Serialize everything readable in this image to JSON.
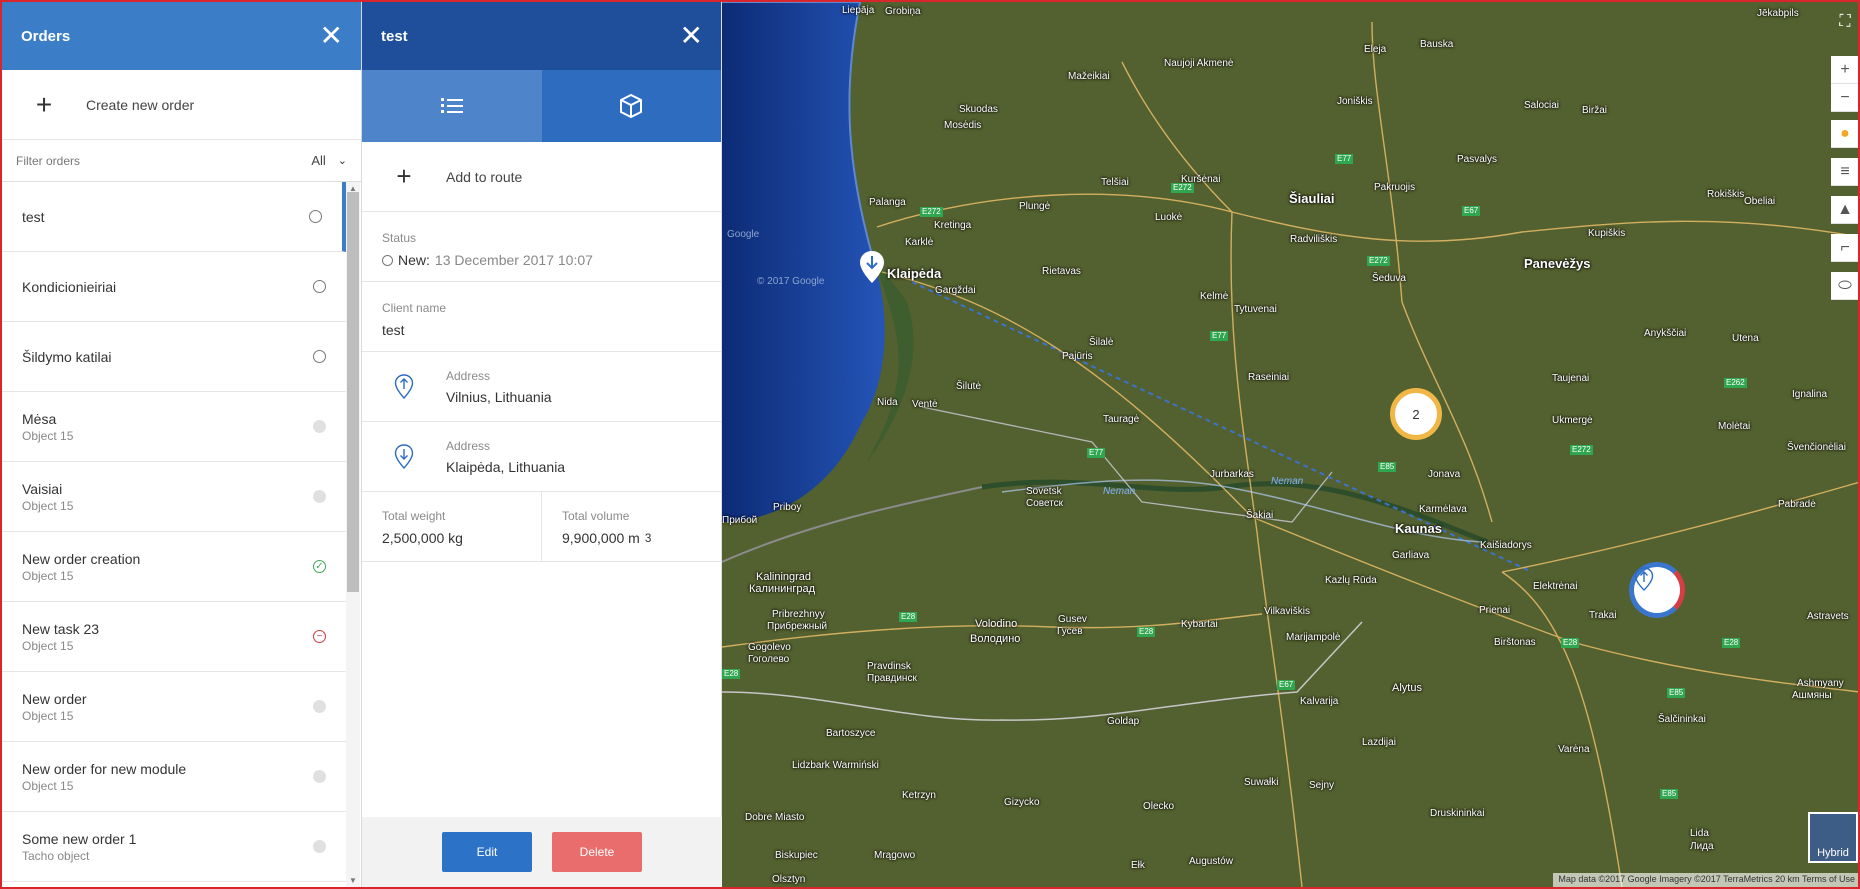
{
  "orders_panel": {
    "title": "Orders",
    "create_label": "Create new order",
    "filter_placeholder": "Filter orders",
    "filter_value": "All",
    "items": [
      {
        "title": "test",
        "subtitle": "",
        "status": "open",
        "active": true
      },
      {
        "title": "Kondicionieiriai",
        "subtitle": "",
        "status": "open"
      },
      {
        "title": "Šildymo katilai",
        "subtitle": "",
        "status": "open"
      },
      {
        "title": "Mėsa",
        "subtitle": "Object 15",
        "status": "grey"
      },
      {
        "title": "Vaisiai",
        "subtitle": "Object 15",
        "status": "grey"
      },
      {
        "title": "New order creation",
        "subtitle": "Object 15",
        "status": "ok"
      },
      {
        "title": "New task 23",
        "subtitle": "Object 15",
        "status": "stop"
      },
      {
        "title": "New order",
        "subtitle": "Object 15",
        "status": "grey"
      },
      {
        "title": "New order for new module",
        "subtitle": "Object 15",
        "status": "grey"
      },
      {
        "title": "Some new order 1",
        "subtitle": "Tacho object",
        "status": "grey"
      }
    ]
  },
  "detail_panel": {
    "title": "test",
    "add_route_label": "Add to route",
    "status_label": "Status",
    "status_value": "New:",
    "status_date": "13 December 2017 10:07",
    "client_label": "Client name",
    "client_value": "test",
    "address_from_label": "Address",
    "address_from_value": "Vilnius, Lithuania",
    "address_to_label": "Address",
    "address_to_value": "Klaipėda, Lithuania",
    "weight_label": "Total weight",
    "weight_value": "2,500,000 kg",
    "volume_label": "Total volume",
    "volume_value": "9,900,000 m",
    "volume_unit_power": "3",
    "edit_label": "Edit",
    "delete_label": "Delete"
  },
  "map": {
    "hybrid_label": "Hybrid",
    "attribution": "Map data ©2017 Google Imagery ©2017 TerraMetrics   20 km   Terms of Use",
    "cluster_count": "2",
    "labels": [
      "Liepāja",
      "Grobiņa",
      "Jēkabpils",
      "Naujoji Akmenė",
      "Mažeikiai",
      "Eleja",
      "Bauska",
      "Skuodas",
      "Joniškis",
      "Biržai",
      "Mosėdis",
      "Salociai",
      "Pasvalys",
      "Palanga",
      "Telšiai",
      "Kuršėnai",
      "Šiauliai",
      "Pakruojis",
      "Kretinga",
      "Plungė",
      "Luokė",
      "Kupiškis",
      "Rokiškis",
      "Obeliai",
      "Klaipėda",
      "Karklė",
      "Gargždai",
      "Rietavas",
      "Radviliškis",
      "Panevėžys",
      "Šeduva",
      "Kelmė",
      "Tytuvenai",
      "Šilalė",
      "Pajūris",
      "Anykščiai",
      "Utena",
      "Raseiniai",
      "Nida",
      "Ventė",
      "Šilutė",
      "Tauragė",
      "Ukmergė",
      "Taujenai",
      "Molėtai",
      "Ignalina",
      "Švenčionėliai",
      "Jurbarkas",
      "Jonava",
      "Pabradė",
      "Sovetsk",
      "Советск",
      "Neman",
      "Šakiai",
      "Kaunas",
      "Karmėlava",
      "Kaišiadorys",
      "Priboy",
      "Прибой",
      "Kaliningrad",
      "Калининград",
      "Garliava",
      "Elektrėnai",
      "Trakai",
      "Astravets",
      "Pribrezhnyy",
      "Прибрежный",
      "Volodino",
      "Володино",
      "Gusev",
      "Гусев",
      "Kybartai",
      "Vilkaviškis",
      "Kazlų Rūda",
      "Prienai",
      "Birštonas",
      "Marijampolė",
      "Gogolevo",
      "Гоголево",
      "Pravdinsk",
      "Правдинск",
      "Kalvarija",
      "Alytus",
      "Ashmyany",
      "Ашмяны",
      "Šalčininkai",
      "Goldap",
      "Bartoszyce",
      "Lazdijai",
      "Varėna",
      "Lidzbark Warmiński",
      "Ketrzyn",
      "Suwałki",
      "Sejny",
      "Gizycko",
      "Olecko",
      "Druskininkai",
      "Dobre Miasto",
      "Biskupiec",
      "Mrągowo",
      "Ełk",
      "Augustów",
      "Lida",
      "Лида",
      "Olsztyn",
      "Google",
      "© 2017 Google",
      "Neman"
    ]
  },
  "colors": {
    "orders_header": "#3b7dc7",
    "detail_header": "#1f4f9b",
    "edit_button": "#2c73c7",
    "delete_button": "#ea6d6e",
    "ok_status": "#42a95c",
    "stop_status": "#d63b43"
  },
  "icons": {
    "plus": "plus-icon",
    "close": "close-icon",
    "list_tab": "list-icon",
    "box_tab": "box-icon",
    "pin_up": "upload-pin-icon",
    "pin_down": "download-pin-icon",
    "dropdown": "chevron-down-icon"
  }
}
